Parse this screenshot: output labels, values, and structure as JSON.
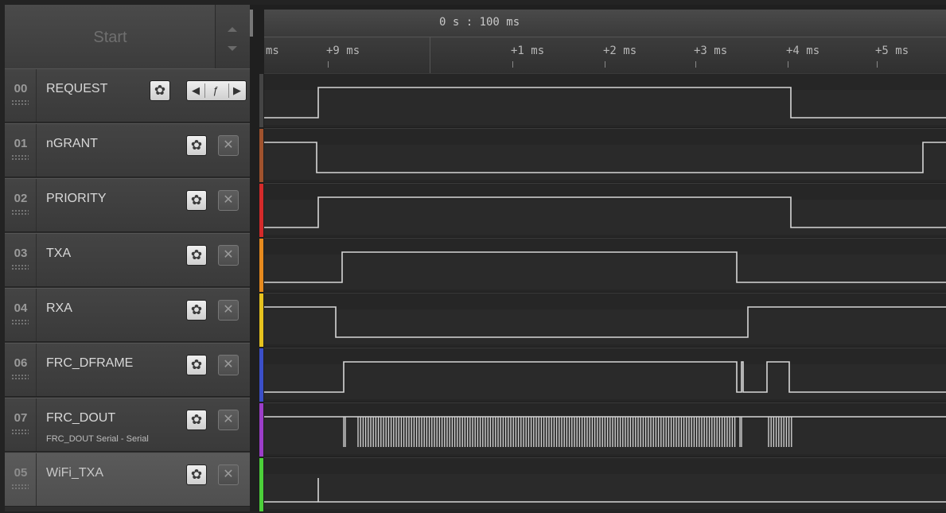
{
  "start": {
    "label": "Start"
  },
  "timeline": {
    "range_label": "0 s : 100 ms",
    "ticks": [
      "ms",
      "+9 ms",
      "+1 ms",
      "+2 ms",
      "+3 ms",
      "+4 ms",
      "+5 ms"
    ]
  },
  "channels": [
    {
      "index": "00",
      "name": "REQUEST",
      "subtitle": "",
      "color": "#444444",
      "trigger": true
    },
    {
      "index": "01",
      "name": "nGRANT",
      "subtitle": "",
      "color": "#a0522d"
    },
    {
      "index": "02",
      "name": "PRIORITY",
      "subtitle": "",
      "color": "#d42a2a"
    },
    {
      "index": "03",
      "name": "TXA",
      "subtitle": "",
      "color": "#e68a1e"
    },
    {
      "index": "04",
      "name": "RXA",
      "subtitle": "",
      "color": "#e6c21e"
    },
    {
      "index": "06",
      "name": "FRC_DFRAME",
      "subtitle": "",
      "color": "#3b4fc8"
    },
    {
      "index": "07",
      "name": "FRC_DOUT",
      "subtitle": "FRC_DOUT Serial - Serial",
      "color": "#9b3ec8"
    },
    {
      "index": "05",
      "name": "WiFi_TXA",
      "subtitle": "",
      "color": "#4ccf3a"
    }
  ],
  "icons": {
    "gear": "gear-icon",
    "close": "close-icon",
    "trigger_left": "arrow-left-icon",
    "trigger_edge": "rising-edge-icon",
    "trigger_right": "arrow-right-icon",
    "spin_up": "chevron-up-icon",
    "spin_down": "chevron-down-icon"
  },
  "glyphs": {
    "gear": "✿",
    "close": "✕",
    "trig_left": "◀",
    "trig_edge": "ƒ",
    "trig_right": "▶"
  }
}
